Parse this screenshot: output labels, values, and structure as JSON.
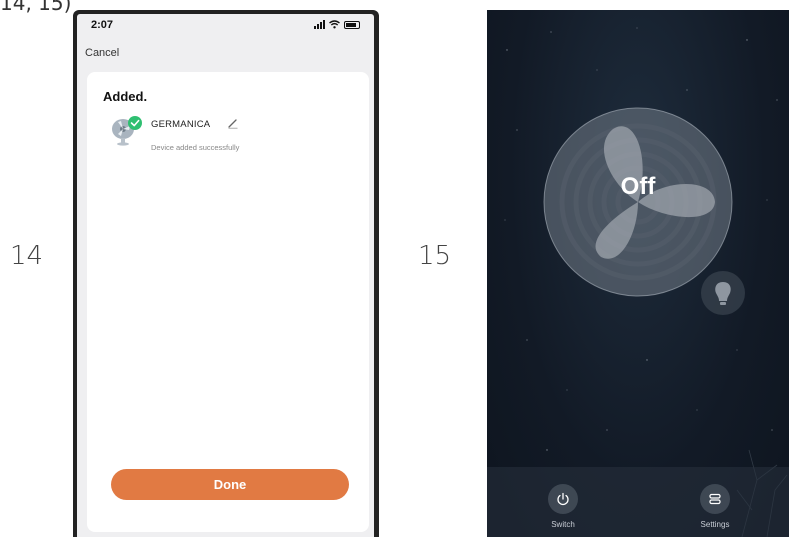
{
  "page_header_fragment": "14, 15)",
  "steps": {
    "left": "14",
    "right": "15"
  },
  "screen14": {
    "status_time": "2:07",
    "cancel_label": "Cancel",
    "added_title": "Added.",
    "device": {
      "name": "GERMANICA",
      "status": "Device added successfully"
    },
    "done_label": "Done",
    "accent_color": "#e17a43",
    "check_color": "#2fbf71"
  },
  "screen15": {
    "power_state": "Off",
    "controls": {
      "switch_label": "Switch",
      "settings_label": "Settings"
    }
  }
}
